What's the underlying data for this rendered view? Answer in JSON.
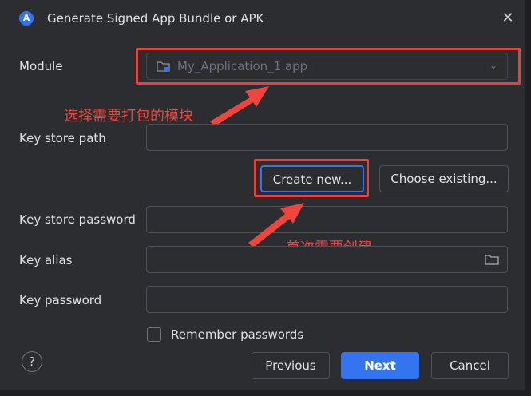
{
  "title": "Generate Signed App Bundle or APK",
  "module": {
    "label": "Module",
    "value": "My_Application_1.app"
  },
  "annotation_module": "选择需要打包的模块",
  "keystore_path": {
    "label": "Key store path",
    "value": ""
  },
  "buttons": {
    "create_new": "Create new...",
    "choose_existing": "Choose existing...",
    "previous": "Previous",
    "next": "Next",
    "cancel": "Cancel"
  },
  "annotation_create": "首次需要创建",
  "keystore_password": {
    "label": "Key store password",
    "value": ""
  },
  "key_alias": {
    "label": "Key alias",
    "value": ""
  },
  "key_password": {
    "label": "Key password",
    "value": ""
  },
  "remember_passwords": {
    "label": "Remember passwords",
    "checked": false
  },
  "help_glyph": "?",
  "close_glyph": "✕",
  "colors": {
    "accent": "#3574f0",
    "annotation_red": "#e8413a",
    "background": "#2b2d30"
  }
}
